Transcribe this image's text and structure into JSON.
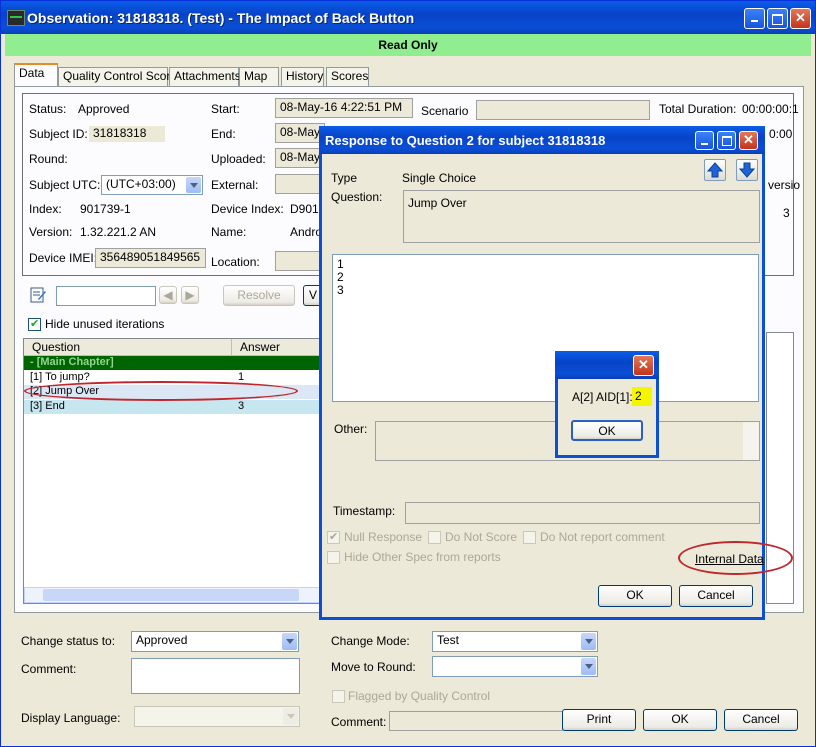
{
  "window": {
    "title": "Observation: 31818318. (Test) - The Impact of Back Button",
    "banner": "Read Only"
  },
  "tabs": [
    "Data",
    "Quality Control Score",
    "Attachments",
    "Map",
    "History",
    "Scores"
  ],
  "info": {
    "status_label": "Status:",
    "status_value": "Approved",
    "subject_id_label": "Subject ID:",
    "subject_id_value": "31818318",
    "round_label": "Round:",
    "subject_utc_label": "Subject UTC:",
    "subject_utc_value": "(UTC+03:00)",
    "index_label": "Index:",
    "index_value": "901739-1",
    "version_label": "Version:",
    "version_value": "1.32.221.2 AN",
    "imei_label": "Device IMEI:",
    "imei_value": "356489051849565",
    "start_label": "Start:",
    "start_value": "08-May-16 4:22:51 PM",
    "end_label": "End:",
    "end_value": "08-May-1",
    "uploaded_label": "Uploaded:",
    "uploaded_value": "08-May-1",
    "external_label": "External:",
    "device_index_label": "Device Index:",
    "device_index_value": "D901",
    "name_label": "Name:",
    "name_value": "Androi",
    "location_label": "Location:",
    "scenario_label": "Scenario",
    "total_duration_label": "Total Duration:",
    "total_duration_value": "00:00:00:1",
    "partial_time_value": "0:00",
    "version_cut_label": "versio",
    "version_cut_value": "3"
  },
  "toolbar": {
    "resolve_label": "Resolve",
    "hide_unused_label": "Hide unused iterations",
    "cut_button_label": "V"
  },
  "grid": {
    "col_question": "Question",
    "col_answer": "Answer",
    "chapter": "- [Main Chapter]",
    "rows": [
      {
        "question": "[1] To jump?",
        "answer": "1"
      },
      {
        "question": "[2] Jump Over",
        "answer": ""
      },
      {
        "question": "[3] End",
        "answer": "3"
      }
    ]
  },
  "dialog": {
    "title": "Response to Question 2 for subject 31818318",
    "type_label": "Type",
    "type_value": "Single Choice",
    "question_label": "Question:",
    "question_value": "Jump Over",
    "answers": [
      "1",
      "2",
      "3"
    ],
    "other_label": "Other:",
    "timestamp_label": "Timestamp:",
    "null_response_label": "Null Response",
    "do_not_score_label": "Do Not Score",
    "do_not_report_label": "Do Not report comment",
    "hide_other_label": "Hide Other Spec from reports",
    "internal_data_label": "Internal Data",
    "ok_label": "OK",
    "cancel_label": "Cancel"
  },
  "msgbox": {
    "text": "A[2] AID[1]:",
    "value": "2",
    "ok_label": "OK"
  },
  "bottom": {
    "change_status_label": "Change status to:",
    "change_status_value": "Approved",
    "comment_label": "Comment:",
    "display_language_label": "Display Language:",
    "change_mode_label": "Change Mode:",
    "change_mode_value": "Test",
    "move_to_round_label": "Move to Round:",
    "flagged_label": "Flagged by Quality Control",
    "comment2_label": "Comment:",
    "print_label": "Print",
    "ok_label": "OK",
    "cancel_label": "Cancel"
  },
  "colors": {
    "titlebar": "#0a4fd6",
    "banner": "#90ee90",
    "chapter_row": "#006400",
    "annotation": "#c0272d",
    "highlight": "#f5f500"
  }
}
